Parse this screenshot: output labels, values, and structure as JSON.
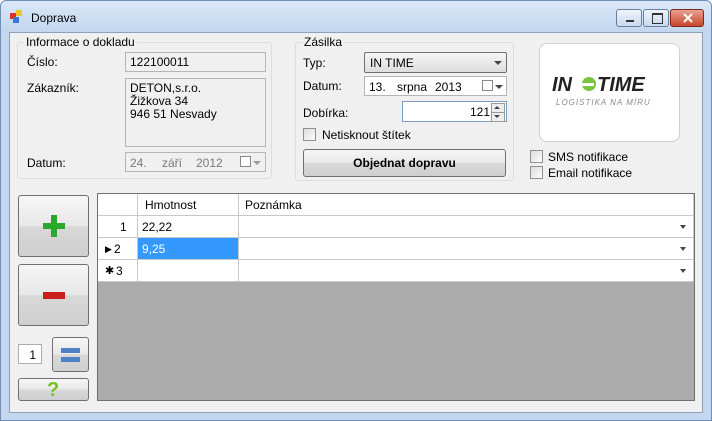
{
  "window": {
    "title": "Doprava"
  },
  "info": {
    "legend": "Informace o dokladu",
    "cislo_label": "Číslo:",
    "cislo_value": "122100011",
    "zakaznik_label": "Zákazník:",
    "zakaznik_lines": [
      "DETON,s.r.o.",
      "Žižkova 34",
      "946 51 Nesvady"
    ],
    "datum_label": "Datum:",
    "datum_day": "24.",
    "datum_month": "září",
    "datum_year": "2012"
  },
  "zasilka": {
    "legend": "Zásilka",
    "typ_label": "Typ:",
    "typ_value": "IN TIME",
    "datum_label": "Datum:",
    "datum_day": "13.",
    "datum_month": "srpna",
    "datum_year": "2013",
    "dobirka_label": "Dobírka:",
    "dobirka_value": "121",
    "netisknout_label": "Netisknout štítek",
    "objednat_label": "Objednat dopravu"
  },
  "notifications": {
    "sms_label": "SMS notifikace",
    "email_label": "Email notifikace"
  },
  "side": {
    "count_value": "1"
  },
  "grid": {
    "columns": [
      "Hmotnost",
      "Poznámka"
    ],
    "rows": [
      {
        "num": "1",
        "marker": "",
        "hmotnost": "22,22",
        "poznamka": ""
      },
      {
        "num": "2",
        "marker": "▶",
        "hmotnost": "9,25",
        "poznamka": ""
      },
      {
        "num": "3",
        "marker": "✱",
        "hmotnost": "",
        "poznamka": ""
      }
    ]
  },
  "colors": {
    "accent_green": "#29a829",
    "accent_red": "#c81e1e",
    "selection": "#3399ff"
  }
}
